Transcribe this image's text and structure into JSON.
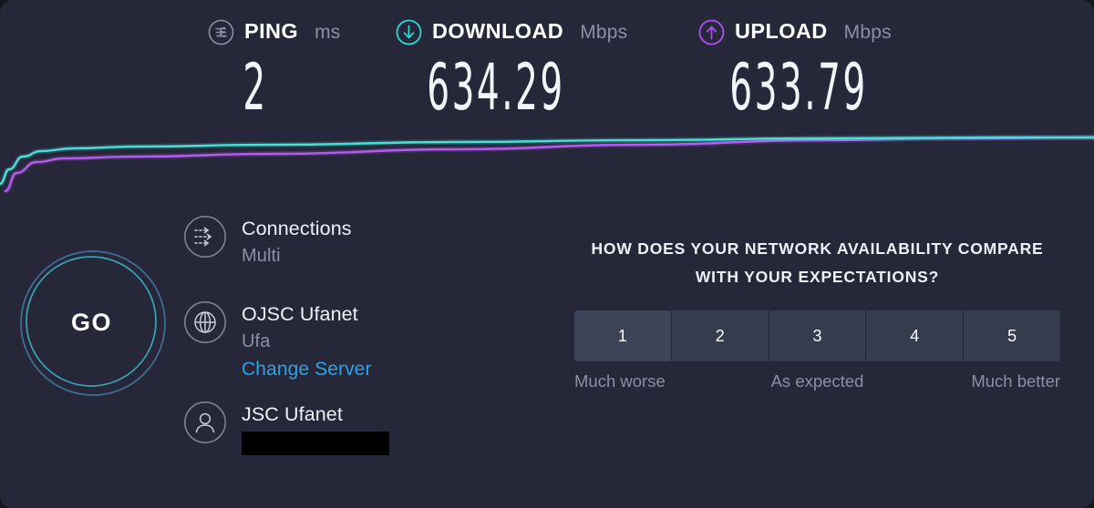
{
  "theme": {
    "panel_bg": "#262839",
    "page_bg": "#15161f",
    "download_accent": "#30d6cf",
    "upload_accent": "#a852ef",
    "ping_accent": "#8b90a6",
    "link_color": "#2aa3e8",
    "muted_text": "#8b90a6",
    "rating_bg": "#363b4d",
    "rating_bg_hover": "#3e4357"
  },
  "metrics": [
    {
      "id": "ping",
      "name": "PING",
      "unit": "ms",
      "value": "2",
      "icon": "ping-icon",
      "accent": "#8b90a6"
    },
    {
      "id": "download",
      "name": "DOWNLOAD",
      "unit": "Mbps",
      "value": "634.29",
      "icon": "download-arrow-icon",
      "accent": "#30d6cf"
    },
    {
      "id": "upload",
      "name": "UPLOAD",
      "unit": "Mbps",
      "value": "633.79",
      "icon": "upload-arrow-icon",
      "accent": "#a852ef"
    }
  ],
  "chart_data": {
    "type": "line",
    "title": "",
    "xlabel": "",
    "ylabel": "",
    "grid": false,
    "legend": "none",
    "series": [
      {
        "name": "Download",
        "color": "#49ded6",
        "points": [
          [
            0,
            62
          ],
          [
            10,
            46
          ],
          [
            25,
            32
          ],
          [
            45,
            26
          ],
          [
            80,
            23
          ],
          [
            150,
            21
          ],
          [
            300,
            19
          ],
          [
            500,
            16
          ],
          [
            700,
            14
          ],
          [
            900,
            12
          ],
          [
            1100,
            11
          ],
          [
            1200,
            11
          ]
        ]
      },
      {
        "name": "Upload",
        "color": "#b45cf0",
        "points": [
          [
            6,
            70
          ],
          [
            18,
            50
          ],
          [
            40,
            38
          ],
          [
            70,
            34
          ],
          [
            150,
            32
          ],
          [
            300,
            29
          ],
          [
            500,
            24
          ],
          [
            700,
            19
          ],
          [
            900,
            14
          ],
          [
            1050,
            12
          ],
          [
            1200,
            11
          ]
        ]
      }
    ]
  },
  "go_button": {
    "label": "GO",
    "ring_outer_color": "#3f6f95",
    "ring_inner_color": "#3ba3b4"
  },
  "info": {
    "connections": {
      "icon": "connections-arrows-icon",
      "title": "Connections",
      "value": "Multi"
    },
    "server": {
      "icon": "globe-icon",
      "title": "OJSC Ufanet",
      "city": "Ufa",
      "change_label": "Change Server"
    },
    "user": {
      "icon": "person-icon",
      "title": "JSC Ufanet",
      "ip_redacted": ""
    }
  },
  "survey": {
    "question": "HOW DOES YOUR NETWORK AVAILABILITY COMPARE WITH YOUR EXPECTATIONS?",
    "options": [
      "1",
      "2",
      "3",
      "4",
      "5"
    ],
    "hovered_index": 0,
    "labels": {
      "low": "Much worse",
      "mid": "As expected",
      "high": "Much better"
    }
  }
}
